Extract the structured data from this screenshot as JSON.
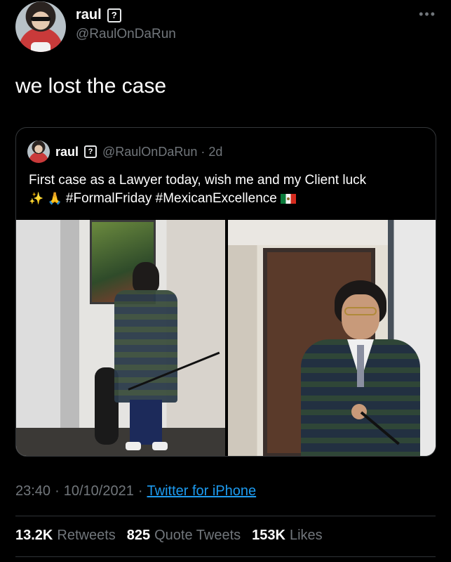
{
  "author": {
    "display_name": "raul",
    "badge": "?",
    "handle": "@RaulOnDaRun",
    "more": "•••"
  },
  "tweet": {
    "text": "we lost the case"
  },
  "quoted": {
    "display_name": "raul",
    "badge": "?",
    "handle_time": "@RaulOnDaRun · 2d",
    "text_line1": "First case as a Lawyer today, wish me and my Client luck",
    "emoji_sparkles": "✨",
    "emoji_pray": "🙏",
    "hashtags": "#FormalFriday #MexicanExcellence"
  },
  "meta": {
    "time": "23:40",
    "sep1": "·",
    "date": "10/10/2021",
    "sep2": "·",
    "source": "Twitter for iPhone"
  },
  "stats": {
    "retweets_count": "13.2K",
    "retweets_label": "Retweets",
    "quotes_count": "825",
    "quotes_label": "Quote Tweets",
    "likes_count": "153K",
    "likes_label": "Likes"
  }
}
